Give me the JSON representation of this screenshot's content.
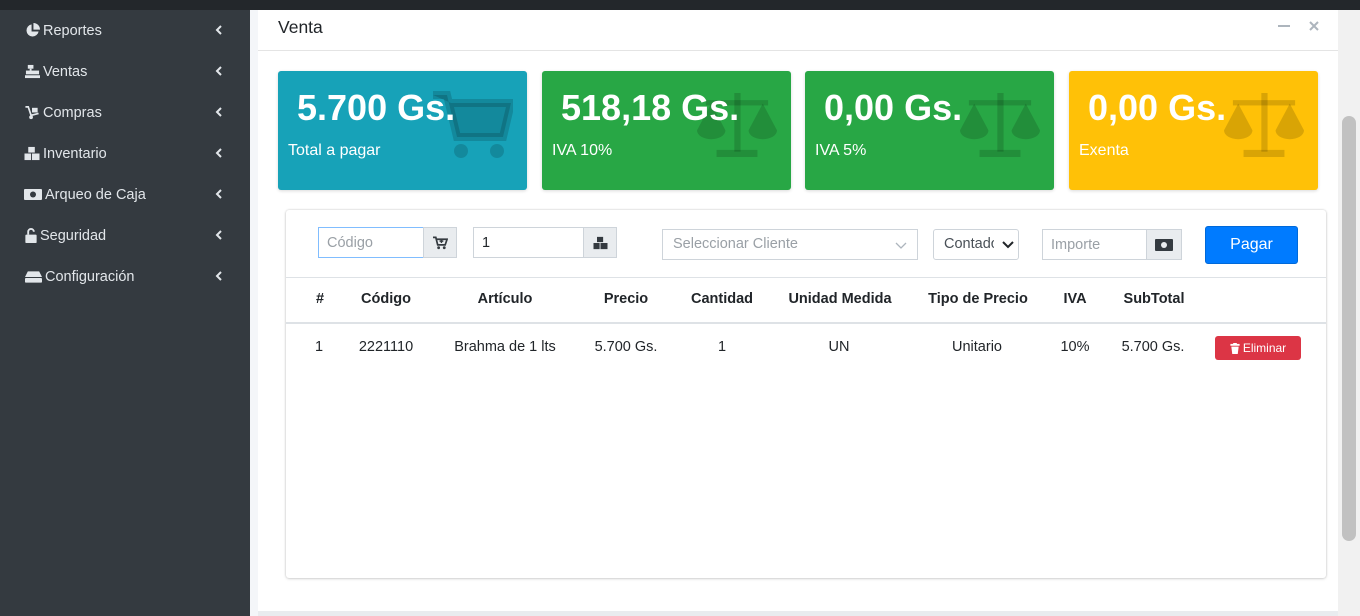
{
  "sidebar": {
    "items": [
      {
        "label": "Reportes",
        "icon": "chart-pie-icon"
      },
      {
        "label": "Ventas",
        "icon": "cash-register-icon"
      },
      {
        "label": "Compras",
        "icon": "dolly-icon"
      },
      {
        "label": "Inventario",
        "icon": "boxes-icon"
      },
      {
        "label": "Arqueo de Caja",
        "icon": "money-bill-icon"
      },
      {
        "label": "Seguridad",
        "icon": "unlock-icon"
      },
      {
        "label": "Configuración",
        "icon": "hdd-icon"
      }
    ]
  },
  "card": {
    "title": "Venta"
  },
  "boxes": [
    {
      "value": "5.700 Gs.",
      "label": "Total a pagar",
      "color": "#17a2b8",
      "icon": "shopping-cart-icon"
    },
    {
      "value": "518,18 Gs.",
      "label": "IVA 10%",
      "color": "#28a745",
      "icon": "balance-scale-icon"
    },
    {
      "value": "0,00 Gs.",
      "label": "IVA 5%",
      "color": "#28a745",
      "icon": "balance-scale-icon"
    },
    {
      "value": "0,00 Gs.",
      "label": "Exenta",
      "color": "#ffc107",
      "icon": "balance-scale-icon"
    }
  ],
  "form": {
    "codigo_placeholder": "Código",
    "cantidad_value": "1",
    "cliente_placeholder": "Seleccionar Cliente",
    "tipo_pago": "Contado",
    "importe_placeholder": "Importe",
    "pagar_label": "Pagar"
  },
  "table": {
    "headers": [
      "#",
      "Código",
      "Artículo",
      "Precio",
      "Cantidad",
      "Unidad Medida",
      "Tipo de Precio",
      "IVA",
      "SubTotal"
    ],
    "rows": [
      {
        "num": "1",
        "codigo": "2221110",
        "articulo": "Brahma de 1 lts",
        "precio": "5.700 Gs.",
        "cantidad": "1",
        "unidad": "UN",
        "tipo_precio": "Unitario",
        "iva": "10%",
        "subtotal": "5.700 Gs.",
        "action": "Eliminar"
      }
    ]
  },
  "colors": {
    "sidebar": "#343a40",
    "primary": "#007bff",
    "danger": "#dc3545",
    "info": "#17a2b8",
    "success": "#28a745",
    "warning": "#ffc107"
  }
}
